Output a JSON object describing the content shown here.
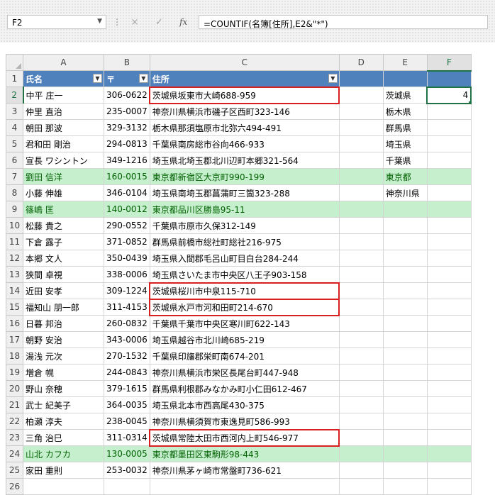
{
  "formula_bar": {
    "name_box": "F2",
    "name_box_dropdown_icon": "chevron-down-icon",
    "cancel_icon": "×",
    "enter_icon": "✓",
    "fx_label": "fx",
    "formula": "=COUNTIF(名簿[住所],E2&\"*\")"
  },
  "columns": [
    "A",
    "B",
    "C",
    "D",
    "E",
    "F"
  ],
  "header_row": {
    "name": "氏名",
    "zip": "〒",
    "address": "住所"
  },
  "rows": [
    {
      "name": "中平 庄一",
      "zip": "306-0622",
      "address": "茨城県坂東市大崎688-959"
    },
    {
      "name": "仲里 直治",
      "zip": "235-0007",
      "address": "神奈川県横浜市磯子区西町323-146"
    },
    {
      "name": "朝田 那波",
      "zip": "329-3132",
      "address": "栃木県那須塩原市北弥六494-491"
    },
    {
      "name": "君和田 剛治",
      "zip": "294-0813",
      "address": "千葉県南房総市谷向466-933"
    },
    {
      "name": "宣長 ワシントン",
      "zip": "349-1216",
      "address": "埼玉県北埼玉郡北川辺町本郷321-564"
    },
    {
      "name": "劉田 信洋",
      "zip": "160-0015",
      "address": "東京都新宿区大京町990-199"
    },
    {
      "name": "小藤 伸雄",
      "zip": "346-0104",
      "address": "埼玉県南埼玉郡菖蒲町三箇323-288"
    },
    {
      "name": "篠嶋 匡",
      "zip": "140-0012",
      "address": "東京都品川区勝島95-11"
    },
    {
      "name": "松藤 貴之",
      "zip": "290-0552",
      "address": "千葉県市原市久保312-149"
    },
    {
      "name": "下倉 露子",
      "zip": "371-0852",
      "address": "群馬県前橋市総社町総社216-975"
    },
    {
      "name": "本郷 文人",
      "zip": "350-0439",
      "address": "埼玉県入間郡毛呂山町目白台284-244"
    },
    {
      "name": "狭間 卓視",
      "zip": "338-0006",
      "address": "埼玉県さいたま市中央区八王子903-158"
    },
    {
      "name": "近田 安孝",
      "zip": "309-1224",
      "address": "茨城県桜川市中泉115-710"
    },
    {
      "name": "福知山 朋一郎",
      "zip": "311-4153",
      "address": "茨城県水戸市河和田町214-670"
    },
    {
      "name": "日暮 邦治",
      "zip": "260-0832",
      "address": "千葉県千葉市中央区寒川町622-143"
    },
    {
      "name": "朝野 安治",
      "zip": "343-0006",
      "address": "埼玉県越谷市北川崎685-219"
    },
    {
      "name": "湯浅 元次",
      "zip": "270-1532",
      "address": "千葉県印旛郡栄町南674-201"
    },
    {
      "name": "増倉 幌",
      "zip": "244-0843",
      "address": "神奈川県横浜市栄区長尾台町447-948"
    },
    {
      "name": "野山 奈穂",
      "zip": "379-1615",
      "address": "群馬県利根郡みなかみ町小仁田612-467"
    },
    {
      "name": "武士 紀美子",
      "zip": "364-0035",
      "address": "埼玉県北本市西高尾430-375"
    },
    {
      "name": "柏瀬 淳夫",
      "zip": "238-0045",
      "address": "神奈川県横須賀市東逸見町586-993"
    },
    {
      "name": "三角 治巳",
      "zip": "311-0314",
      "address": "茨城県常陸太田市西河内上町546-977"
    },
    {
      "name": "山北 カフカ",
      "zip": "130-0005",
      "address": "東京都墨田区東駒形98-443"
    },
    {
      "name": "家田 重則",
      "zip": "253-0032",
      "address": "神奈川県茅ヶ崎市常盤町736-621"
    }
  ],
  "prefectures": [
    "茨城県",
    "栃木県",
    "群馬県",
    "埼玉県",
    "千葉県",
    "東京都",
    "神奈川県"
  ],
  "f2_value": "4",
  "highlight_color_green": "#c6efce",
  "highlight_text_green": "#006100",
  "table_header_color": "#4f81bd",
  "red_box_color": "#d92020"
}
